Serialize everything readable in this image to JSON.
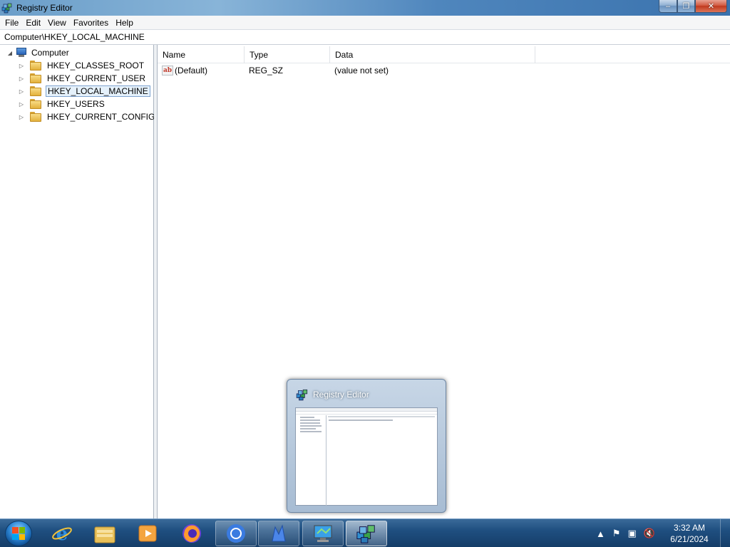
{
  "window": {
    "title": "Registry Editor",
    "controls": {
      "minimize": "–",
      "maximize": "❐",
      "close": "✕"
    }
  },
  "menu": [
    "File",
    "Edit",
    "View",
    "Favorites",
    "Help"
  ],
  "address": "Computer\\HKEY_LOCAL_MACHINE",
  "tree": {
    "root": "Computer",
    "items": [
      {
        "label": "HKEY_CLASSES_ROOT",
        "selected": false
      },
      {
        "label": "HKEY_CURRENT_USER",
        "selected": false
      },
      {
        "label": "HKEY_LOCAL_MACHINE",
        "selected": true
      },
      {
        "label": "HKEY_USERS",
        "selected": false
      },
      {
        "label": "HKEY_CURRENT_CONFIG",
        "selected": false
      }
    ]
  },
  "list": {
    "columns": [
      "Name",
      "Type",
      "Data"
    ],
    "rows": [
      {
        "name": "(Default)",
        "type": "REG_SZ",
        "data": "(value not set)"
      }
    ]
  },
  "preview": {
    "title": "Registry Editor"
  },
  "taskbar": {
    "apps": [
      "internet-explorer",
      "file-explorer",
      "media-player",
      "firefox",
      "chrome",
      "app-blue",
      "monitor",
      "registry-editor"
    ],
    "clock": {
      "time": "3:32 AM",
      "date": "6/21/2024"
    }
  },
  "colors": {
    "taskbar": "#1f4f80",
    "selection": "#e5f1fb",
    "titlebar": "#6b9ec9"
  }
}
